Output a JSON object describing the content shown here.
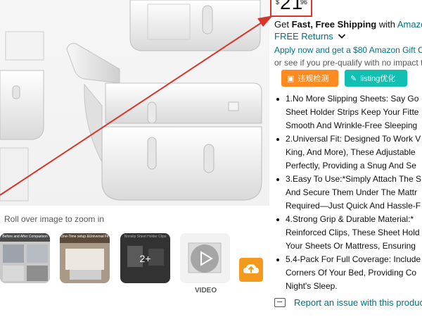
{
  "gallery": {
    "zoom_hint": "Roll over image to zoom in",
    "thumbs": [
      {
        "caption": "Before and After Comparison"
      },
      {
        "caption": "One-Time setup &Universal Fit"
      },
      {
        "caption": "Nonslip Sheet Holder Clips"
      },
      {
        "more_count": "2+"
      },
      {
        "label": "VIDEO"
      }
    ]
  },
  "price": {
    "currency": "$",
    "whole": "21",
    "fraction": "96"
  },
  "shipping": {
    "get": "Get",
    "fast_free": "Fast, Free Shipping",
    "with": "with",
    "service": "Amazon"
  },
  "returns": "FREE Returns",
  "apply_line": "Apply now and get a $80 Amazon Gift C",
  "prequal_line": "or see if you pre-qualify with no impact t",
  "tools": {
    "violation": "违规检测",
    "listing": "listing优化"
  },
  "bullets": [
    "1.No More Slipping Sheets: Say Go",
    "Sheet Holder Strips Keep Your Fitte",
    "Smooth And Wrinkle-Free Sleeping",
    "2.Universal Fit: Designed To Work V",
    "King, And More), These Adjustable",
    "Perfectly, Providing a Snug And Se",
    "3.Easy To Use:*Simply Attach The S",
    "And Secure Them Under The Mattr",
    "Required—Just Quick And Hassle-F",
    "4.Strong Grip & Durable Material:*",
    "Reinforced Clips, These Sheet Hold",
    "Your Sheets Or Mattress, Ensuring",
    "5.4-Pack For Full Coverage: Include",
    "Corners Of Your Bed, Providing Co",
    "Night's Sleep."
  ],
  "report": "Report an issue with this product",
  "colors": {
    "link": "#007185",
    "annotation_red": "#d8352a",
    "orange_button": "#ff8a1f",
    "teal_button": "#12bfb1",
    "upload_orange": "#f39a1e"
  }
}
